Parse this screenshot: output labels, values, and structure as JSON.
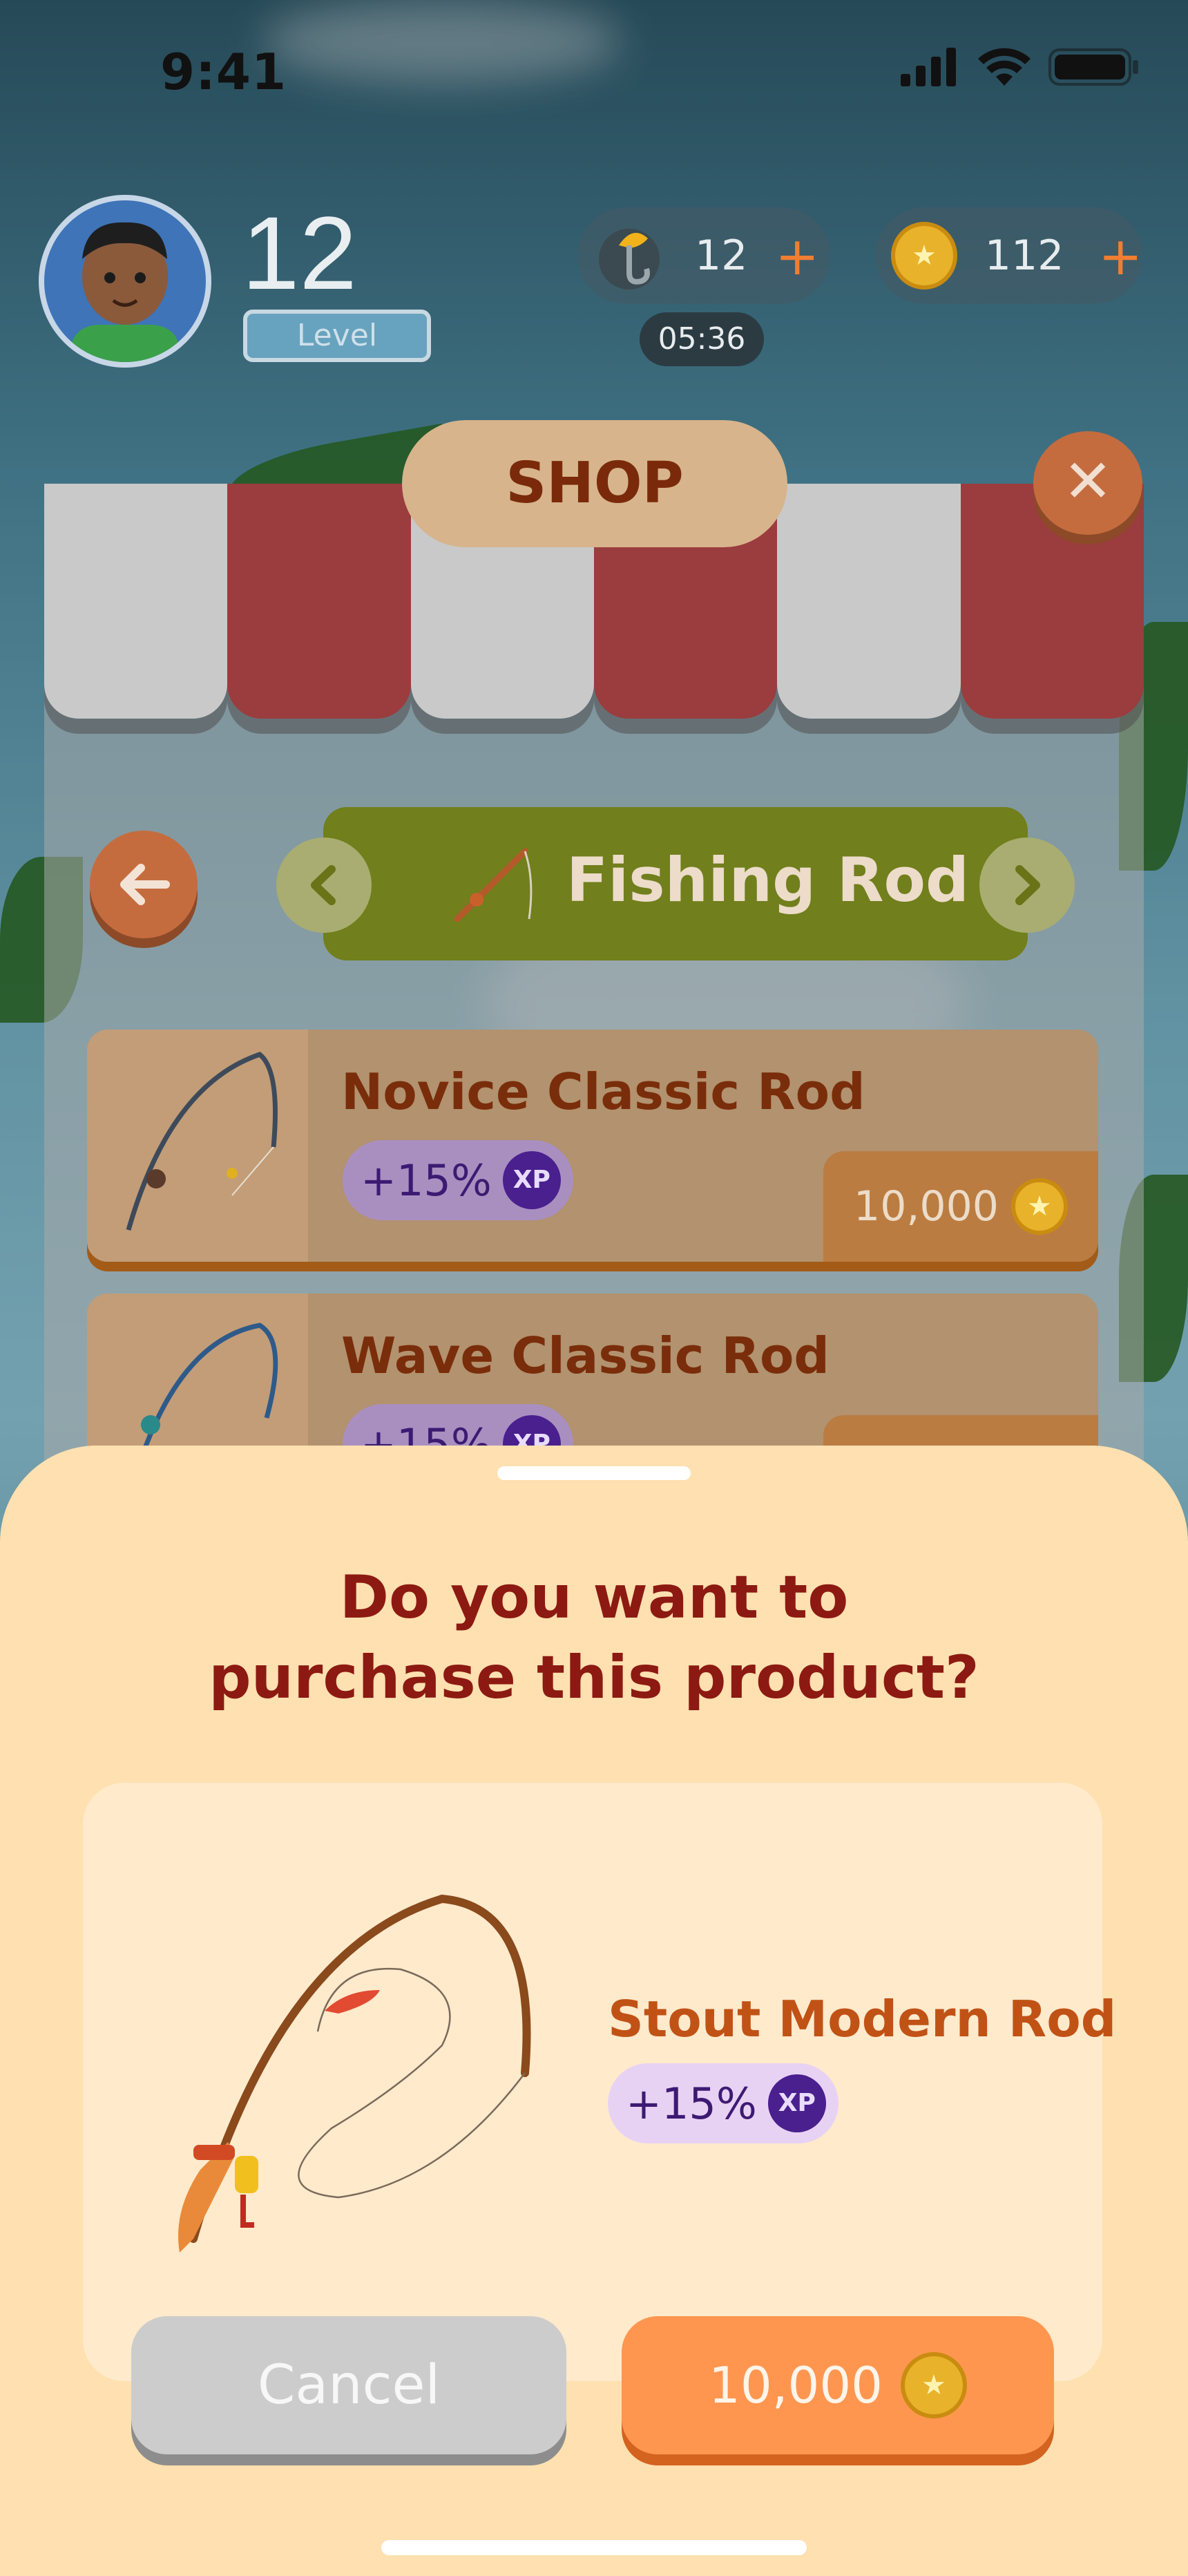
{
  "status_bar": {
    "time": "9:41"
  },
  "player": {
    "level": "12",
    "level_label": "Level"
  },
  "resources": {
    "bait": {
      "count": "12",
      "plus": "+",
      "timer": "05:36"
    },
    "coins": {
      "count": "112",
      "plus": "+"
    }
  },
  "shop": {
    "title": "SHOP",
    "close_symbol": "✕",
    "category": {
      "label": "Fishing Rod",
      "prev": "‹",
      "next": "›"
    },
    "items": [
      {
        "name": "Novice Classic Rod",
        "xp": "+15%",
        "xp_badge": "XP",
        "price": "10,000"
      },
      {
        "name": "Wave Classic Rod",
        "xp": "+15%",
        "xp_badge": "XP",
        "price": ""
      }
    ]
  },
  "dialog": {
    "title_line1": "Do you want to",
    "title_line2": "purchase this product?",
    "product": {
      "name": "Stout Modern Rod",
      "xp": "+15%",
      "xp_badge": "XP"
    },
    "cancel_label": "Cancel",
    "buy_price": "10,000"
  },
  "colors": {
    "accent_orange": "#ff9650",
    "sheet_bg": "#ffe0b0",
    "title_red": "#8c1a12",
    "category_green": "#717f1c",
    "xp_purple": "#4a1f8e"
  }
}
